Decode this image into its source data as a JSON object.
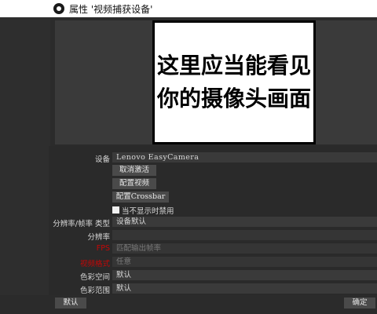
{
  "window": {
    "title": "属性 '视频捕获设备'"
  },
  "preview": {
    "line1": "这里应当能看见",
    "line2": "你的摄像头画面"
  },
  "settings": {
    "device": {
      "label": "设备",
      "value": "Lenovo EasyCamera"
    },
    "buttons": {
      "deactivate": "取消激活",
      "configure_video": "配置视频",
      "configure_crossbar": "配置Crossbar"
    },
    "hide_when_inactive": {
      "label": "当不显示时禁用",
      "checked": false
    },
    "resolution_type": {
      "label": "分辨率/帧率 类型",
      "value": "设备默认"
    },
    "resolution": {
      "label": "分辨率",
      "value": ""
    },
    "fps": {
      "label": "FPS",
      "value": "匹配输出帧率"
    },
    "video_format": {
      "label": "视频格式",
      "value": "任意"
    },
    "color_space": {
      "label": "色彩空间",
      "value": "默认"
    },
    "color_range": {
      "label": "色彩范围",
      "value": "默认"
    }
  },
  "footer": {
    "defaults_label": "默认",
    "ok_label": "确定"
  }
}
